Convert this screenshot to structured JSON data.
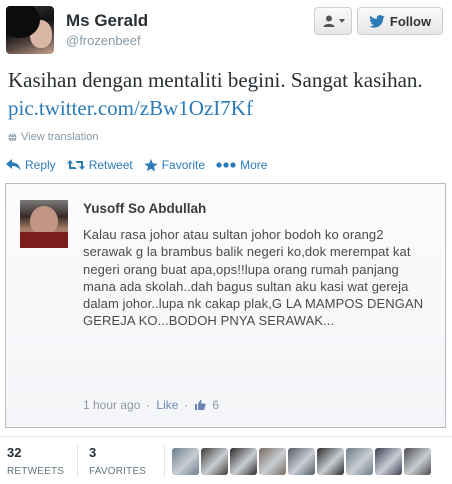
{
  "profile": {
    "name": "Ms Gerald",
    "handle": "@frozenbeef"
  },
  "header": {
    "follow_label": "Follow",
    "user_menu_icon": "user-dropdown-icon"
  },
  "tweet": {
    "text": "Kasihan dengan mentaliti begini. Sangat kasihan. ",
    "link": "pic.twitter.com/zBw1OzI7Kf",
    "view_translation": "View translation"
  },
  "actions": [
    {
      "label": "Reply",
      "icon": "reply-icon"
    },
    {
      "label": "Retweet",
      "icon": "retweet-icon"
    },
    {
      "label": "Favorite",
      "icon": "star-icon"
    },
    {
      "label": "More",
      "icon": "more-dots-icon"
    }
  ],
  "embedded_post": {
    "author": "Yusoff So Abdullah",
    "text": "Kalau rasa johor atau sultan johor bodoh ko orang2 serawak g la brambus balik negeri ko,dok merempat kat negeri orang buat apa,ops!!lupa orang rumah panjang mana ada skolah..dah bagus sultan aku kasi wat gereja dalam johor..lupa nk cakap plak,G LA MAMPOS DENGAN GEREJA KO...BODOH PNYA SERAWAK...",
    "time": "1 hour ago",
    "sep": "·",
    "like_label": "Like",
    "like_count": "6"
  },
  "stats": {
    "retweets": {
      "count": "32",
      "label": "RETWEETS"
    },
    "favorites": {
      "count": "3",
      "label": "FAVORITES"
    }
  },
  "colors": {
    "link": "#2b7bb9",
    "muted": "#8899a6"
  },
  "favoriters": [
    "#6b7d8c",
    "#3f3a36",
    "#2e2a2a",
    "#7a6a60",
    "#545b66",
    "#2a2a2a",
    "#6d7a84",
    "#3b3f54",
    "#4c4c4c",
    "#8a8f96",
    "#5b6b4d"
  ]
}
